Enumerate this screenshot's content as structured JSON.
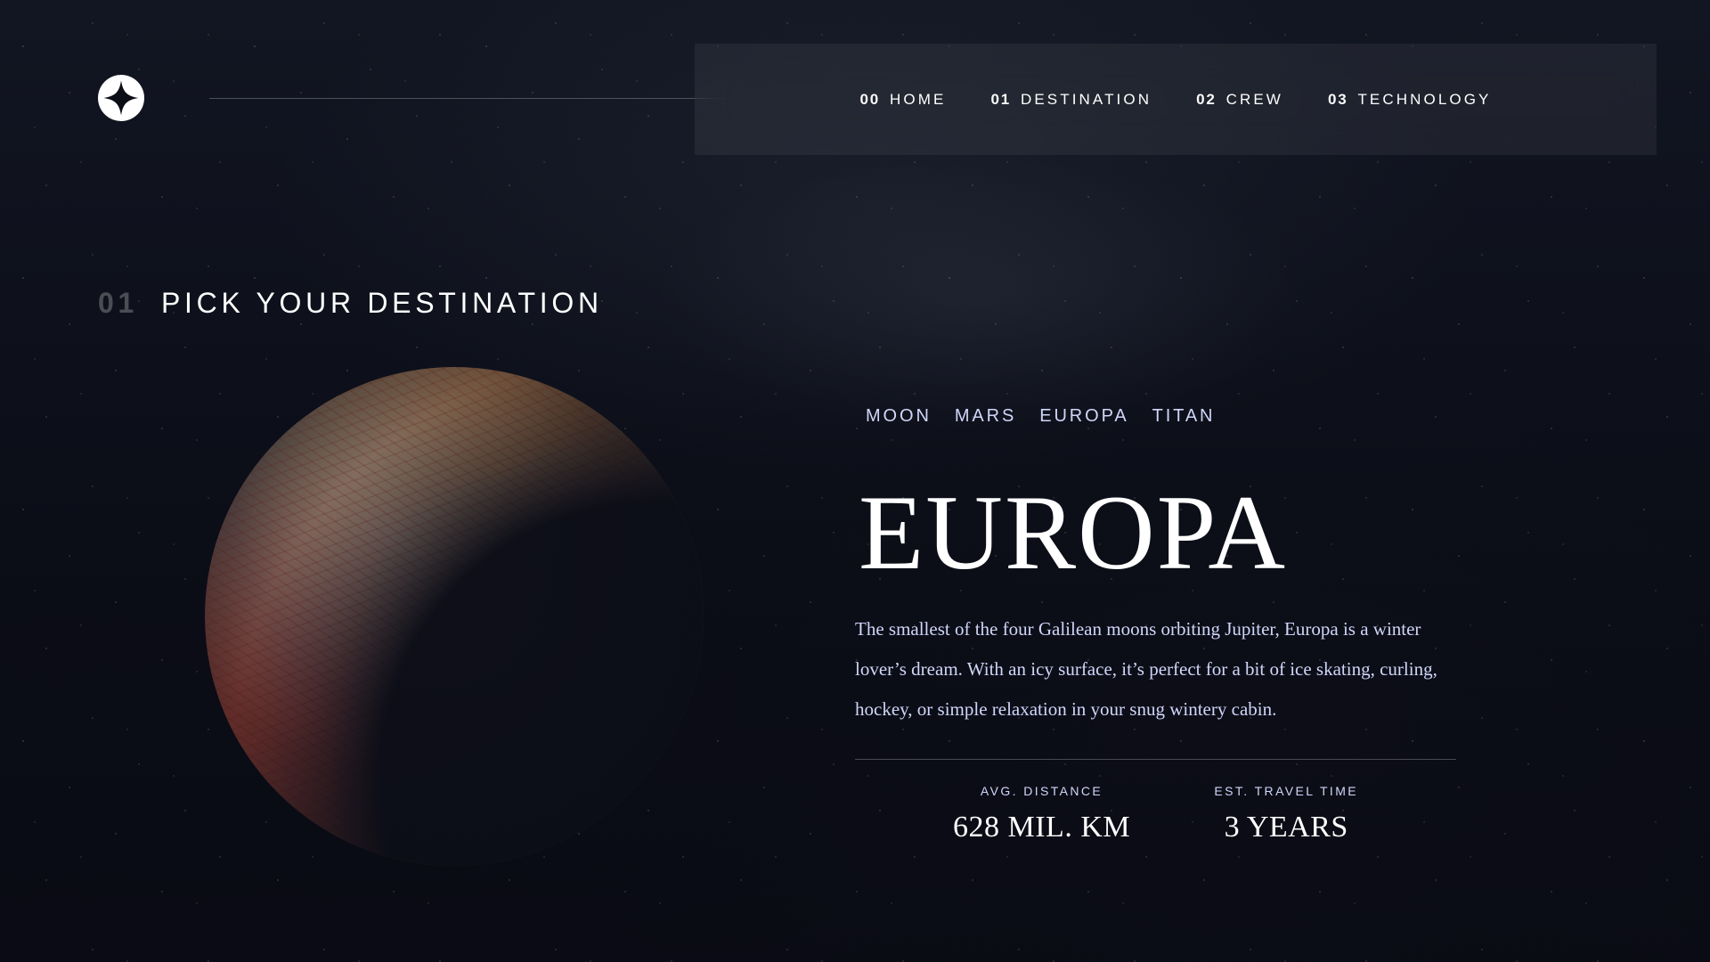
{
  "colors": {
    "background": "#0b0d17",
    "text_primary": "#ffffff",
    "text_secondary": "#d0d6f9"
  },
  "header": {
    "logo_icon": "star-logo-icon",
    "nav": [
      {
        "num": "00",
        "label": "HOME"
      },
      {
        "num": "01",
        "label": "DESTINATION"
      },
      {
        "num": "02",
        "label": "CREW"
      },
      {
        "num": "03",
        "label": "TECHNOLOGY"
      }
    ]
  },
  "page": {
    "title_num": "01",
    "title": "PICK YOUR DESTINATION"
  },
  "destination": {
    "tabs": [
      "MOON",
      "MARS",
      "EUROPA",
      "TITAN"
    ],
    "name": "EUROPA",
    "description": "The smallest of the four Galilean moons orbiting Jupiter, Europa is a winter lover’s dream. With an icy surface, it’s perfect for a bit of ice skating, curling, hockey, or simple relaxation in your snug wintery cabin.",
    "stats": [
      {
        "label": "AVG. DISTANCE",
        "value": "628 MIL. KM"
      },
      {
        "label": "EST. TRAVEL TIME",
        "value": "3 YEARS"
      }
    ]
  }
}
